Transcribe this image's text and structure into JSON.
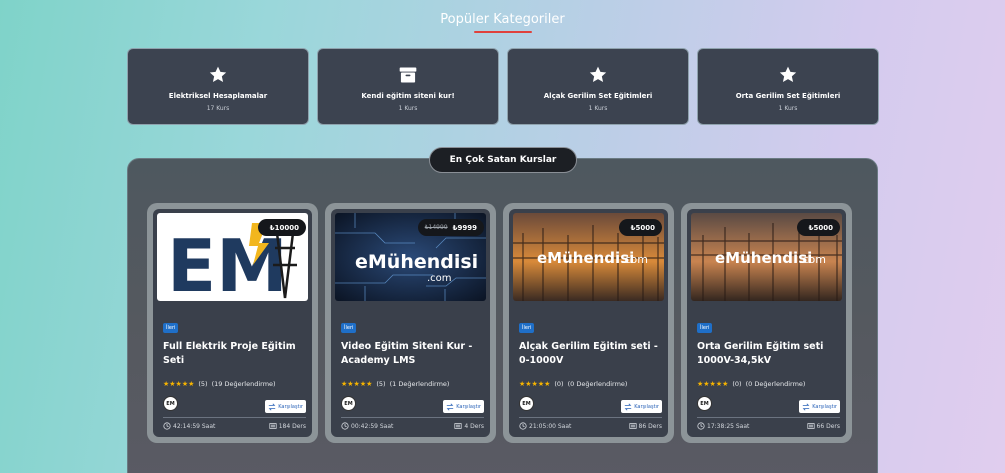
{
  "section": {
    "title": "Popüler Kategoriler"
  },
  "categories": [
    {
      "name": "Elektriksel Hesaplamalar",
      "count": "17 Kurs",
      "icon": "star-icon"
    },
    {
      "name": "Kendi eğitim siteni kur!",
      "count": "1 Kurs",
      "icon": "archive-box-icon"
    },
    {
      "name": "Alçak Gerilim Set Eğitimleri",
      "count": "1 Kurs",
      "icon": "star-icon"
    },
    {
      "name": "Orta Gerilim Set Eğitimleri",
      "count": "1 Kurs",
      "icon": "star-icon"
    }
  ],
  "bestseller": {
    "label": "En Çok Satan Kurslar"
  },
  "courses": [
    {
      "thumb": "em-logo",
      "old_price": "",
      "price": "₺10000",
      "level": "İleri",
      "title": "Full Elektrik Proje Eğitim Seti",
      "stars": "★★★★★",
      "rating_count": "(5)",
      "reviews": "(19 Değerlendirme)",
      "avatar": "EM",
      "compare": "Karşılaştır",
      "duration": "42:14:59 Saat",
      "lessons": "184 Ders"
    },
    {
      "thumb": "emuhendisi-circuit",
      "old_price": "₺14999",
      "price": "₺9999",
      "level": "İleri",
      "title": "Video Eğitim Siteni Kur - Academy LMS",
      "stars": "★★★★★",
      "rating_count": "(5)",
      "reviews": "(1 Değerlendirme)",
      "avatar": "EM",
      "compare": "Karşılaştır",
      "duration": "00:42:59 Saat",
      "lessons": "4 Ders"
    },
    {
      "thumb": "emuhendisi-substation",
      "old_price": "",
      "price": "₺5000",
      "level": "İleri",
      "title": "Alçak Gerilim Eğitim seti - 0-1000V",
      "stars": "★★★★★",
      "rating_count": "(0)",
      "reviews": "(0 Değerlendirme)",
      "avatar": "EM",
      "compare": "Karşılaştır",
      "duration": "21:05:00 Saat",
      "lessons": "86 Ders"
    },
    {
      "thumb": "emuhendisi-substation",
      "old_price": "",
      "price": "₺5000",
      "level": "İleri",
      "title": "Orta Gerilim Eğitim seti 1000V-34,5kV",
      "stars": "★★★★★",
      "rating_count": "(0)",
      "reviews": "(0 Değerlendirme)",
      "avatar": "EM",
      "compare": "Karşılaştır",
      "duration": "17:38:25 Saat",
      "lessons": "66 Ders"
    }
  ],
  "thumb_text": {
    "brand": "eMühendisi",
    "suffix": ".com",
    "logo": "EM"
  },
  "colors": {
    "accent_underline": "#e0413c",
    "card_bg": "#3a404b",
    "level_badge": "#1f6fc8",
    "star": "#f5b301"
  }
}
